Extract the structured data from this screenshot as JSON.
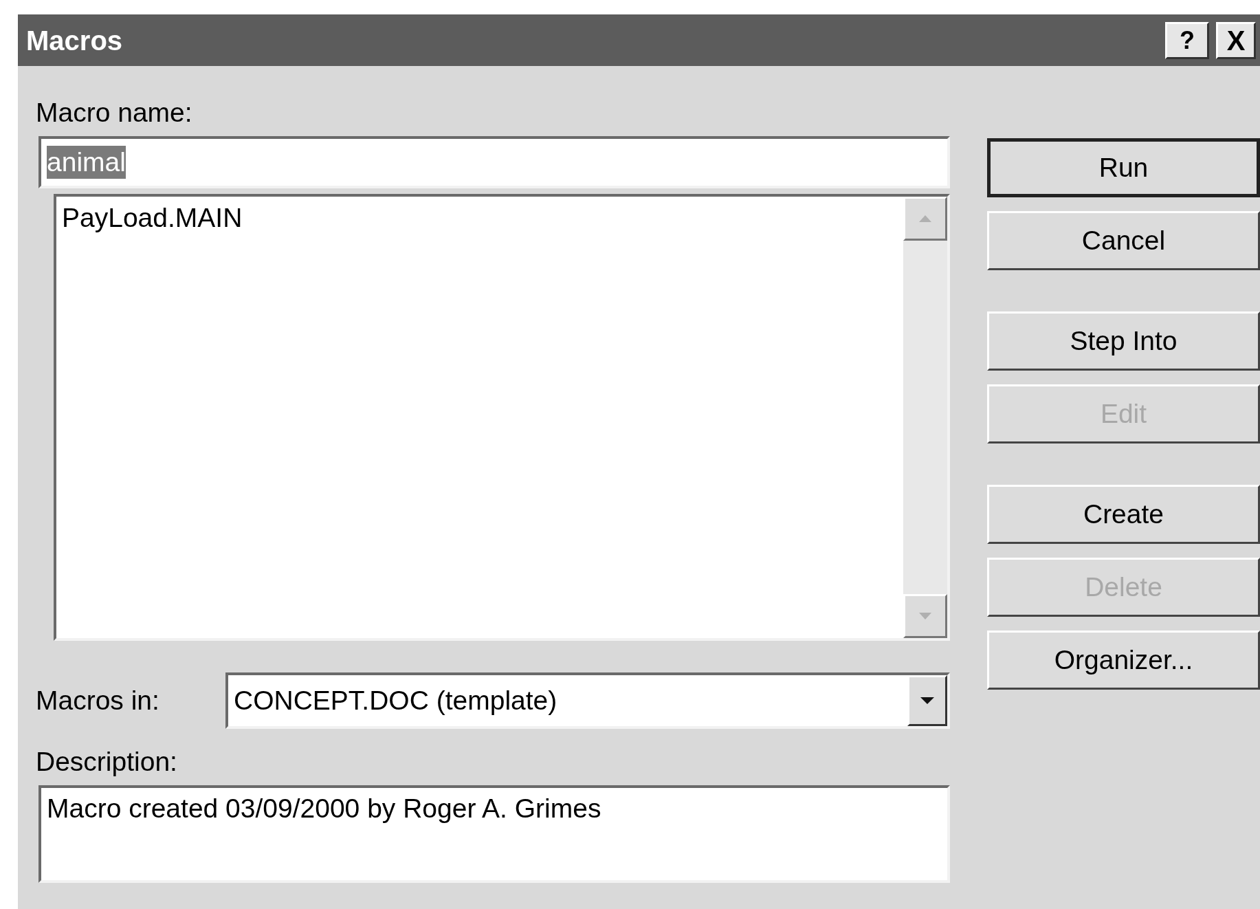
{
  "window": {
    "title": "Macros"
  },
  "title_buttons": [
    {
      "kind": "help",
      "label": "?"
    },
    {
      "kind": "close",
      "label": "X"
    }
  ],
  "macro_name": {
    "label": "Macro name:",
    "value": "animal",
    "selected": true
  },
  "macro_list": {
    "items": [
      {
        "label": "PayLoad.MAIN",
        "selected": false
      }
    ]
  },
  "macros_in": {
    "label": "Macros in:",
    "value": "CONCEPT.DOC (template)"
  },
  "description": {
    "label": "Description:",
    "value": "Macro created 03/09/2000 by Roger A. Grimes"
  },
  "buttons": [
    {
      "label": "Run",
      "default": true,
      "disabled": false
    },
    {
      "label": "Cancel",
      "default": false,
      "disabled": false
    },
    {
      "label": "Step Into",
      "default": false,
      "disabled": false
    },
    {
      "label": "Edit",
      "default": false,
      "disabled": true
    },
    {
      "label": "Create",
      "default": false,
      "disabled": false
    },
    {
      "label": "Delete",
      "default": false,
      "disabled": true
    },
    {
      "label": "Organizer...",
      "default": false,
      "disabled": false
    }
  ]
}
